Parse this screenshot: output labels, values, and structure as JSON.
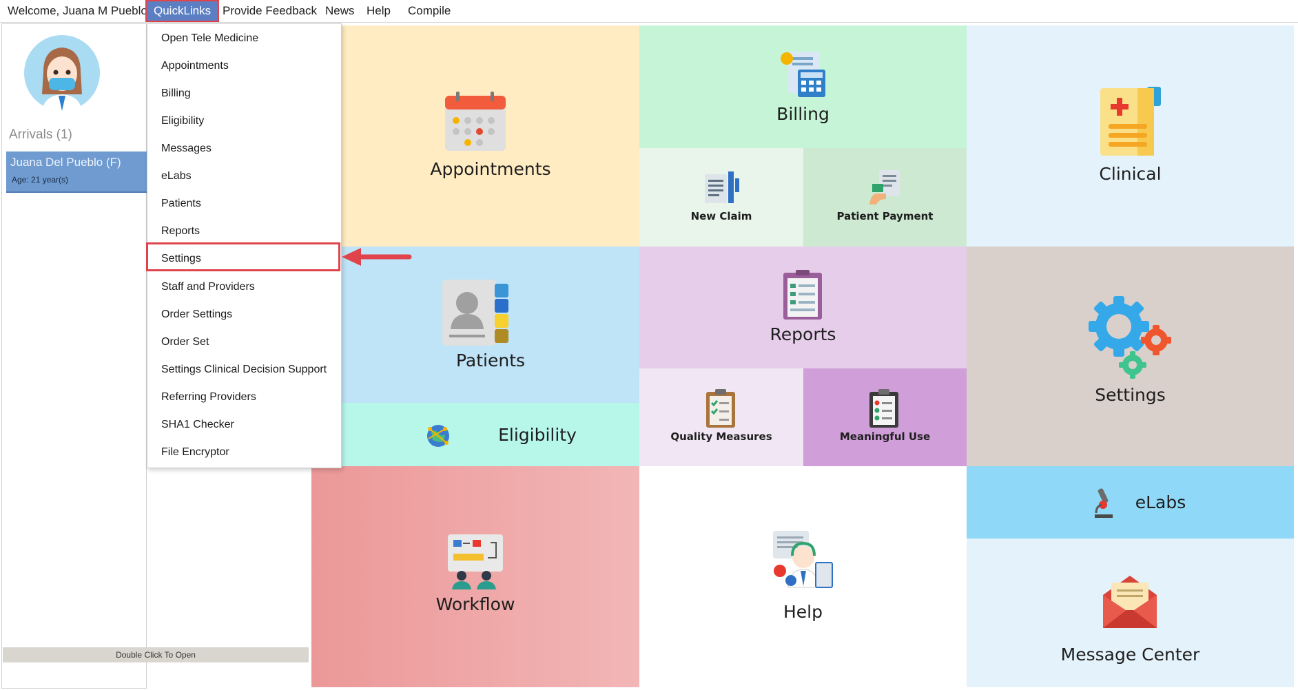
{
  "menubar": {
    "welcome": "Welcome, Juana M Pueblo",
    "items": [
      "QuickLinks",
      "Provide Feedback",
      "News",
      "Help",
      "Compile"
    ]
  },
  "left_panel": {
    "arrivals": "Arrivals (1)",
    "patient_name": "Juana Del Pueblo (F)",
    "patient_age": "Age: 21 year(s)",
    "open_hint": "Double Click To Open"
  },
  "dropdown": {
    "items": [
      "Open Tele Medicine",
      "Appointments",
      "Billing",
      "Eligibility",
      "Messages",
      "eLabs",
      "Patients",
      "Reports",
      "Settings",
      "Staff and Providers",
      "Order Settings",
      "Order Set",
      "Settings Clinical Decision Support",
      "Referring Providers",
      "SHA1 Checker",
      "File Encryptor"
    ],
    "highlighted": "Settings"
  },
  "tiles": {
    "appointments": "Appointments",
    "billing": "Billing",
    "new_claim": "New Claim",
    "patient_payment": "Patient Payment",
    "clinical": "Clinical",
    "patients": "Patients",
    "eligibility": "Eligibility",
    "reports": "Reports",
    "quality_measures": "Quality Measures",
    "meaningful_use": "Meaningful Use",
    "settings": "Settings",
    "workflow": "Workflow",
    "help": "Help",
    "elabs": "eLabs",
    "message_center": "Message Center"
  },
  "colors": {
    "menu_active": "#5b7fc2",
    "annotation_red": "#e0434a",
    "appointments_bg": "#ffecc2",
    "billing_bg": "#c5f5d6",
    "clinical_bg": "#e4f2fb",
    "patients_bg": "#bfe4f7",
    "eligibility_bg": "#b7f7ea",
    "reports_bg": "#e6cdea",
    "settings_bg": "#d9d0cc",
    "workflow_bg": "#ee9e9e",
    "elabs_bg": "#8fd8f7"
  }
}
